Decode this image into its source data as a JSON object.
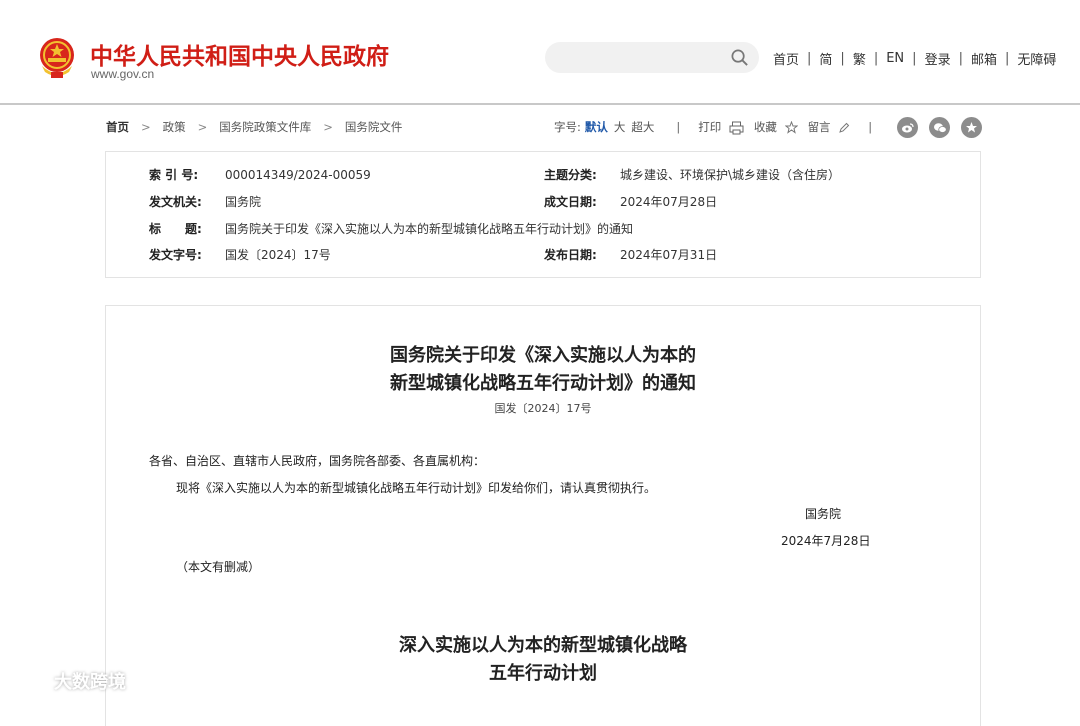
{
  "header": {
    "site_name": "中华人民共和国中央人民政府",
    "site_url": "www.gov.cn",
    "search_placeholder": "",
    "nav": [
      "首页",
      "简",
      "繁",
      "EN",
      "登录",
      "邮箱",
      "无障碍"
    ],
    "nav_separator": "|"
  },
  "breadcrumb": {
    "items": [
      "首页",
      "政策",
      "国务院政策文件库",
      "国务院文件"
    ],
    "arrow": ">"
  },
  "tools": {
    "font_label": "字号:",
    "font_default": "默认",
    "font_large": "大",
    "font_xlarge": "超大",
    "separator": "|",
    "print": "打印",
    "favorite": "收藏",
    "comment": "留言"
  },
  "meta": {
    "index_label": "索 引 号:",
    "index_value": "000014349/2024-00059",
    "category_label": "主题分类:",
    "category_value": "城乡建设、环境保护\\城乡建设（含住房）",
    "issuer_label": "发文机关:",
    "issuer_value": "国务院",
    "written_label": "成文日期:",
    "written_value": "2024年07月28日",
    "title_label": "标　　题:",
    "title_value": "国务院关于印发《深入实施以人为本的新型城镇化战略五年行动计划》的通知",
    "docno_label": "发文字号:",
    "docno_value": "国发〔2024〕17号",
    "published_label": "发布日期:",
    "published_value": "2024年07月31日"
  },
  "article": {
    "title_line1": "国务院关于印发《深入实施以人为本的",
    "title_line2": "新型城镇化战略五年行动计划》的通知",
    "doc_number": "国发〔2024〕17号",
    "salutation": "各省、自治区、直辖市人民政府，国务院各部委、各直属机构：",
    "body": "现将《深入实施以人为本的新型城镇化战略五年行动计划》印发给你们，请认真贯彻执行。",
    "signature": "国务院",
    "date": "2024年7月28日",
    "note": "（本文有删减）",
    "subtitle_line1": "深入实施以人为本的新型城镇化战略",
    "subtitle_line2": "五年行动计划"
  },
  "watermark": {
    "text": "大数跨境"
  },
  "colors": {
    "brand_red": "#d01e16",
    "link_blue": "#1f58a8",
    "border": "#e3e3e3"
  }
}
